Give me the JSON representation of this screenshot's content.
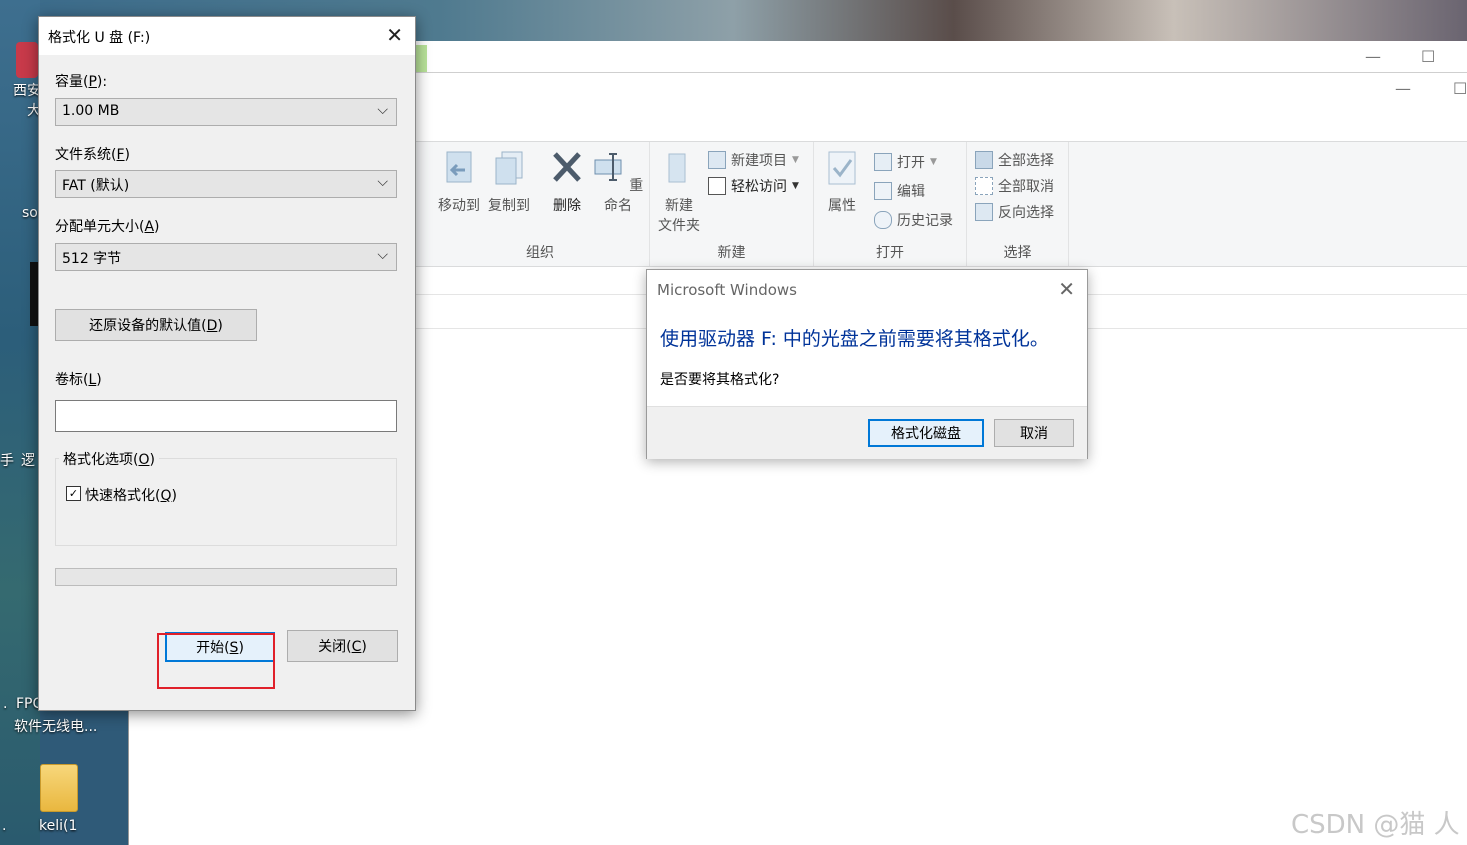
{
  "desktop": {
    "icon_labels": [
      "西安",
      "大",
      "so",
      "手",
      "逻",
      ".",
      "FPC",
      "软件无线电...",
      "keli(1",
      "."
    ],
    "folder_label": "keli(1"
  },
  "explorer": {
    "ribbon": {
      "organize": {
        "label": "组织",
        "move_to": "移动到",
        "copy_to": "复制到",
        "delete": "删除",
        "rename": "重命名"
      },
      "new": {
        "label": "新建",
        "new_item": "新建项目",
        "easy_access": "轻松访问",
        "new_folder_line1": "新建",
        "new_folder_line2": "文件夹"
      },
      "open": {
        "label": "打开",
        "properties": "属性",
        "open": "打开",
        "edit": "编辑",
        "history": "历史记录"
      },
      "select": {
        "label": "选择",
        "select_all": "全部选择",
        "select_none": "全部取消",
        "invert": "反向选择"
      }
    }
  },
  "format_dialog": {
    "title": "格式化 U 盘 (F:)",
    "capacity_label": "容量(",
    "capacity_key": "P",
    "capacity_value": "1.00 MB",
    "filesystem_label": "文件系统(",
    "filesystem_key": "F",
    "filesystem_value": "FAT (默认)",
    "alloc_label": "分配单元大小(",
    "alloc_key": "A",
    "alloc_value": "512 字节",
    "restore_label": "还原设备的默认值(",
    "restore_key": "D",
    "volume_label": "卷标(",
    "volume_key": "L",
    "volume_value": "",
    "options_label": "格式化选项(",
    "options_key": "O",
    "quick_label": "快速格式化(",
    "quick_key": "Q",
    "quick_checked": true,
    "progress": 0,
    "start_label": "开始(",
    "start_key": "S",
    "close_label": "关闭(",
    "close_key": "C"
  },
  "message_box": {
    "title": "Microsoft Windows",
    "main_text": "使用驱动器 F: 中的光盘之前需要将其格式化。",
    "sub_text": "是否要将其格式化?",
    "format_button": "格式化磁盘",
    "cancel_button": "取消"
  },
  "watermark": "CSDN @猫 人"
}
